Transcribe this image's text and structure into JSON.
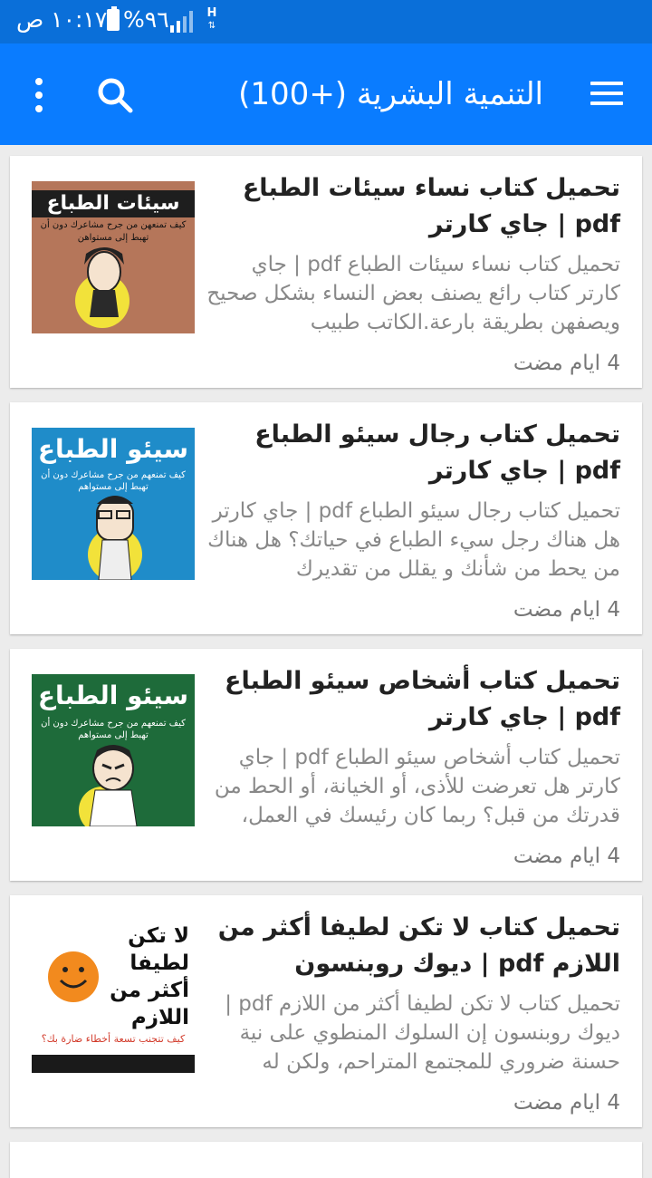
{
  "status_bar": {
    "time": "١٠:١٧ ص",
    "battery": "%٩٦",
    "data_label": "H"
  },
  "app_bar": {
    "title": "التنمية البشرية (+100)",
    "menu_icon": "hamburger-menu-icon",
    "search_icon": "search-icon",
    "more_icon": "more-vertical-icon"
  },
  "colors": {
    "status_bar": "#0a6fd9",
    "app_bar": "#0a7cff",
    "background": "#ececec"
  },
  "articles": [
    {
      "title": "تحميل كتاب نساء سيئات الطباع pdf | جاي كارتر",
      "excerpt": "تحميل كتاب نساء سيئات الطباع pdf | جاي كارتر كتاب رائع يصنف بعض النساء بشكل صحيح ويصفهن بطريقة بارعة.الكاتب طبيب",
      "time": "4 ايام مضت",
      "cover": {
        "headline": "سيئات الطباع",
        "tagline": "كيف تمنعهن من جرح مشاعرك دون أن تهبط إلى مستواهن",
        "bg": "#b5765a"
      }
    },
    {
      "title": "تحميل كتاب رجال سيئو الطباع pdf | جاي كارتر",
      "excerpt": "تحميل كتاب رجال سيئو الطباع pdf | جاي كارتر هل هناك رجل سيء الطباع في حياتك؟ هل هناك من يحط من شأنك و يقلل من تقديرك",
      "time": "4 ايام مضت",
      "cover": {
        "headline": "سيئو الطباع",
        "tagline": "كيف تمنعهم من جرح مشاعرك دون أن تهبط إلى مستواهم",
        "bg": "#1f8cc9"
      }
    },
    {
      "title": "تحميل كتاب أشخاص سيئو الطباع pdf | جاي كارتر",
      "excerpt": "تحميل كتاب أشخاص سيئو الطباع pdf | جاي كارتر هل تعرضت للأذى، أو الخيانة، أو الحط من قدرتك من قبل؟ ربما كان رئيسك في العمل،",
      "time": "4 ايام مضت",
      "cover": {
        "headline": "سيئو الطباع",
        "tagline": "كيف تمنعهم من جرح مشاعرك دون أن تهبط إلى مستواهم",
        "bg": "#1e6b3a"
      }
    },
    {
      "title": "تحميل كتاب لا تكن لطيفا أكثر من اللازم pdf | ديوك روبنسون",
      "excerpt": "تحميل كتاب لا تكن لطيفا أكثر من اللازم pdf | ديوك روبنسون إن السلوك المنطوي على نية حسنة ضروري للمجتمع المتراحم، ولكن له",
      "time": "4 ايام مضت",
      "cover": {
        "headline": "لا تكن لطيفا أكثر من اللازم",
        "tagline": "كيف تتجنب تسعة أخطاء ضارة بك؟",
        "bg": "#ffffff"
      }
    }
  ]
}
